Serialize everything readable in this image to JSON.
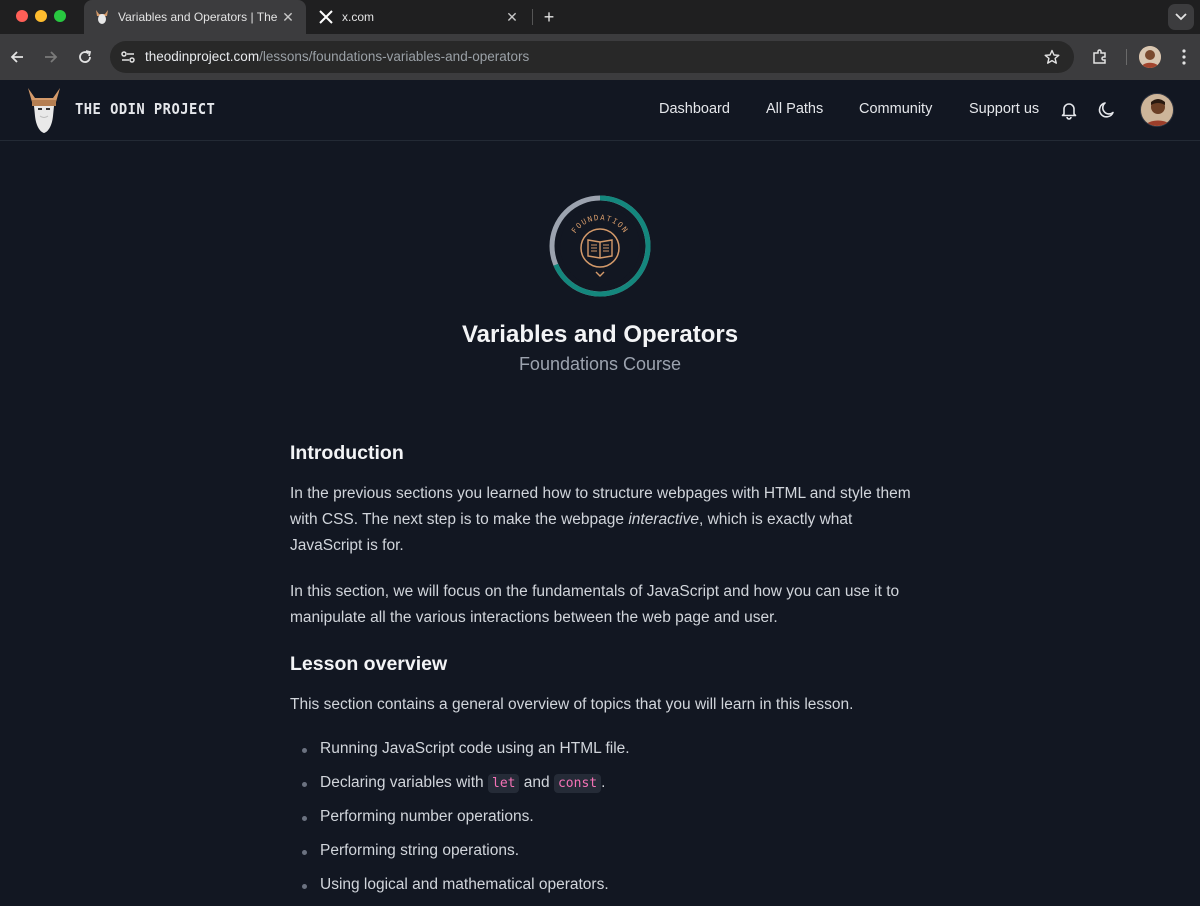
{
  "browser": {
    "tabs": [
      {
        "title": "Variables and Operators | The Odin Project",
        "active": true,
        "favicon": "odin-favicon"
      },
      {
        "title": "x.com",
        "active": false,
        "favicon": "x-favicon"
      }
    ],
    "url_host": "theodinproject.com",
    "url_path": "/lessons/foundations-variables-and-operators"
  },
  "site": {
    "brand": "THE ODIN PROJECT",
    "nav": [
      "Dashboard",
      "All Paths",
      "Community",
      "Support us"
    ]
  },
  "lesson": {
    "badge_label": "FOUNDATION",
    "title": "Variables and Operators",
    "course": "Foundations Course",
    "intro_heading": "Introduction",
    "intro_p1_before": "In the previous sections you learned how to structure webpages with HTML and style them with CSS. The next step is to make the webpage ",
    "intro_p1_em": "interactive",
    "intro_p1_after": ", which is exactly what JavaScript is for.",
    "intro_p2": "In this section, we will focus on the fundamentals of JavaScript and how you can use it to manipulate all the various interactions between the web page and user.",
    "overview_heading": "Lesson overview",
    "overview_p": "This section contains a general overview of topics that you will learn in this lesson.",
    "bullets": [
      "Running JavaScript code using an HTML file.",
      {
        "before": "Declaring variables with ",
        "code1": "let",
        "middle": " and ",
        "code2": "const",
        "after": "."
      },
      "Performing number operations.",
      "Performing string operations.",
      "Using logical and mathematical operators."
    ]
  },
  "colors": {
    "page_bg": "#121722",
    "badge_teal": "#14877d",
    "badge_gray": "#9ca3af",
    "badge_gold": "#d49a6a",
    "inline_code": "#f472b6"
  }
}
